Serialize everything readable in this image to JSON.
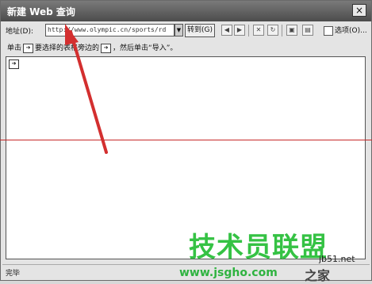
{
  "window": {
    "title": "新建 Web 查询",
    "close_label": "×"
  },
  "toolbar": {
    "address_label": "地址(D):",
    "address_value": "http://www.olympic.cn/sports/rd",
    "go_label": "转到(G)",
    "options_label": "选项(O)..."
  },
  "instruction": {
    "part1": "单击",
    "part2": "要选择的表格旁边的",
    "part3": "，然后单击“导入”。"
  },
  "status": {
    "text": "完毕"
  },
  "watermark": {
    "brand": "技术员联盟",
    "net": "jb51.net",
    "url": "www.jsgho.com",
    "home": "之家"
  },
  "icons": {
    "back": "back-icon",
    "forward": "forward-icon",
    "stop": "stop-icon",
    "refresh": "refresh-icon",
    "show_icons": "show-icons-icon",
    "save": "save-query-icon",
    "options": "options-icon",
    "table_marker": "table-select-arrow-icon"
  },
  "colors": {
    "title_bar": "#5a5a5a",
    "annotation_arrow": "#d32f2f",
    "guide_line": "#c62828",
    "watermark_green": "#35c244"
  }
}
